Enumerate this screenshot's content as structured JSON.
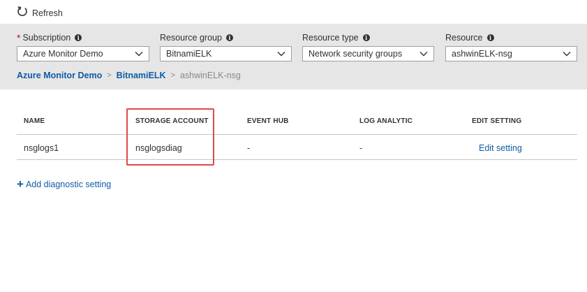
{
  "toolbar": {
    "refresh_label": "Refresh",
    "refresh_icon": "refresh-icon"
  },
  "filters": {
    "subscription": {
      "label": "Subscription",
      "required_mark": "*",
      "value": "Azure Monitor Demo"
    },
    "resource_group": {
      "label": "Resource group",
      "value": "BitnamiELK"
    },
    "resource_type": {
      "label": "Resource type",
      "value": "Network security groups"
    },
    "resource": {
      "label": "Resource",
      "value": "ashwinELK-nsg"
    },
    "info_glyph": "i"
  },
  "breadcrumb": {
    "items": [
      "Azure Monitor Demo",
      "BitnamiELK",
      "ashwinELK-nsg"
    ],
    "separator": ">"
  },
  "table": {
    "columns": [
      "NAME",
      "STORAGE ACCOUNT",
      "EVENT HUB",
      "LOG ANALYTIC",
      "EDIT SETTING"
    ],
    "rows": [
      {
        "name": "nsglogs1",
        "storage_account": "nsglogsdiag",
        "event_hub": "-",
        "log_analytic": "-",
        "edit": "Edit setting"
      }
    ]
  },
  "actions": {
    "add_setting_icon": "+",
    "add_setting_label": "Add diagnostic setting"
  },
  "colors": {
    "link": "#0f5ba7",
    "panel_bg": "#e6e6e6",
    "highlight": "#e0484c"
  }
}
